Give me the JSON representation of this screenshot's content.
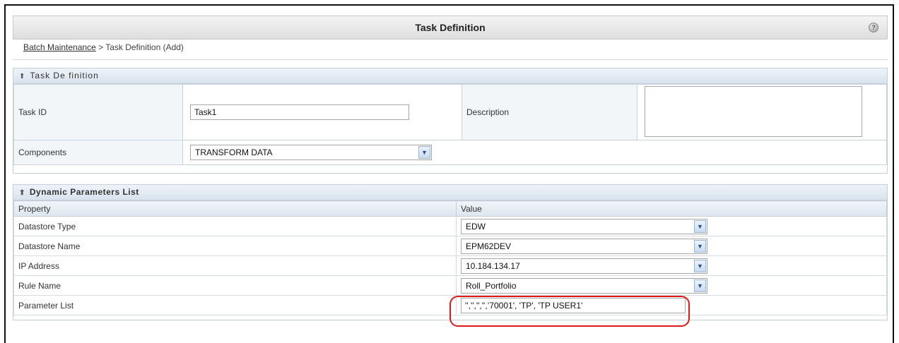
{
  "header": {
    "title": "Task Definition",
    "help_icon": "help-icon"
  },
  "breadcrumb": {
    "parent": "Batch Maintenance",
    "separator": " > ",
    "current": "Task Definition (Add)"
  },
  "task_section": {
    "title": "Task De finition",
    "task_id_label": "Task ID",
    "task_id_value": "Task1",
    "description_label": "Description",
    "description_value": "",
    "components_label": "Components",
    "components_value": "TRANSFORM DATA"
  },
  "params_section": {
    "title": "Dynamic Parameters List",
    "columns": {
      "property": "Property",
      "value": "Value"
    },
    "rows": [
      {
        "property": "Datastore Type",
        "value": "EDW",
        "control": "select"
      },
      {
        "property": "Datastore Name",
        "value": "EPM62DEV",
        "control": "select"
      },
      {
        "property": "IP Address",
        "value": "10.184.134.17",
        "control": "select"
      },
      {
        "property": "Rule Name",
        "value": "Roll_Portfolio",
        "control": "select"
      },
      {
        "property": "Parameter List",
        "value": "'','','','',’70001', 'TP', 'TP USER1'",
        "control": "text"
      }
    ]
  },
  "colors": {
    "highlight": "#e01818",
    "section_header": "#d9e3ee",
    "dropdown_arrow": "#2a4f86"
  }
}
